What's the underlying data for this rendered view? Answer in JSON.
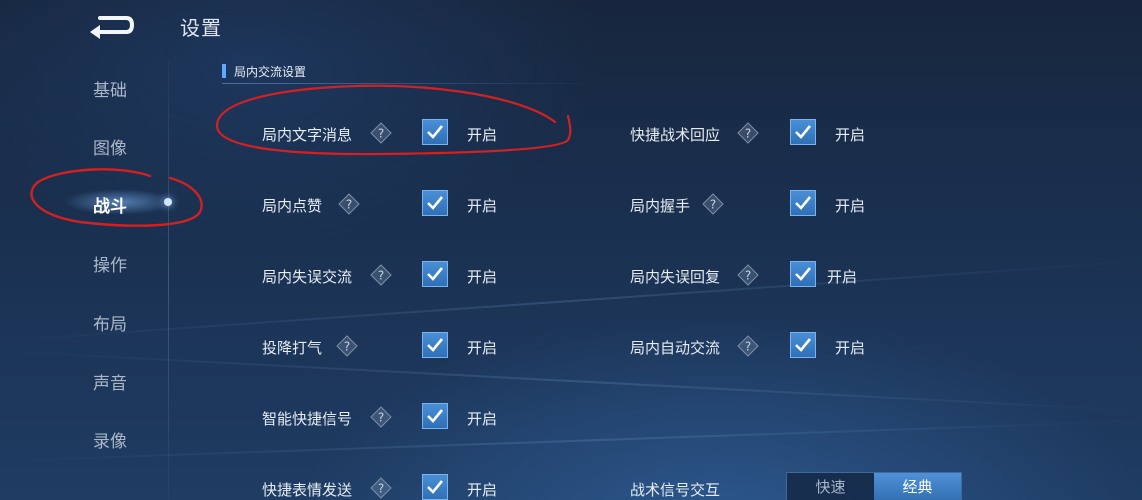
{
  "header": {
    "title": "设置"
  },
  "sidebar": {
    "items": [
      {
        "label": "基础",
        "active": false
      },
      {
        "label": "图像",
        "active": false
      },
      {
        "label": "战斗",
        "active": true
      },
      {
        "label": "操作",
        "active": false
      },
      {
        "label": "布局",
        "active": false
      },
      {
        "label": "声音",
        "active": false
      },
      {
        "label": "录像",
        "active": false
      }
    ]
  },
  "section": {
    "title": "局内交流设置"
  },
  "settings": {
    "left": [
      {
        "label": "局内文字消息",
        "checked": true,
        "state": "开启"
      },
      {
        "label": "局内点赞",
        "checked": true,
        "state": "开启"
      },
      {
        "label": "局内失误交流",
        "checked": true,
        "state": "开启"
      },
      {
        "label": "投降打气",
        "checked": true,
        "state": "开启"
      },
      {
        "label": "智能快捷信号",
        "checked": true,
        "state": "开启"
      },
      {
        "label": "快捷表情发送",
        "checked": true,
        "state": "开启"
      }
    ],
    "right": [
      {
        "label": "快捷战术回应",
        "checked": true,
        "state": "开启"
      },
      {
        "label": "局内握手",
        "checked": true,
        "state": "开启"
      },
      {
        "label": "局内失误回复",
        "checked": true,
        "state": "开启"
      },
      {
        "label": "局内自动交流",
        "checked": true,
        "state": "开启"
      }
    ],
    "tactical_signal": {
      "label": "战术信号交互",
      "options": [
        "快速",
        "经典"
      ],
      "selected": "经典"
    }
  },
  "colors": {
    "accent": "#4a8fd6",
    "annotation": "#d42020"
  },
  "icons": {
    "back": "back-arrow-icon",
    "help": "help-diamond-icon",
    "check": "checkmark-icon"
  }
}
